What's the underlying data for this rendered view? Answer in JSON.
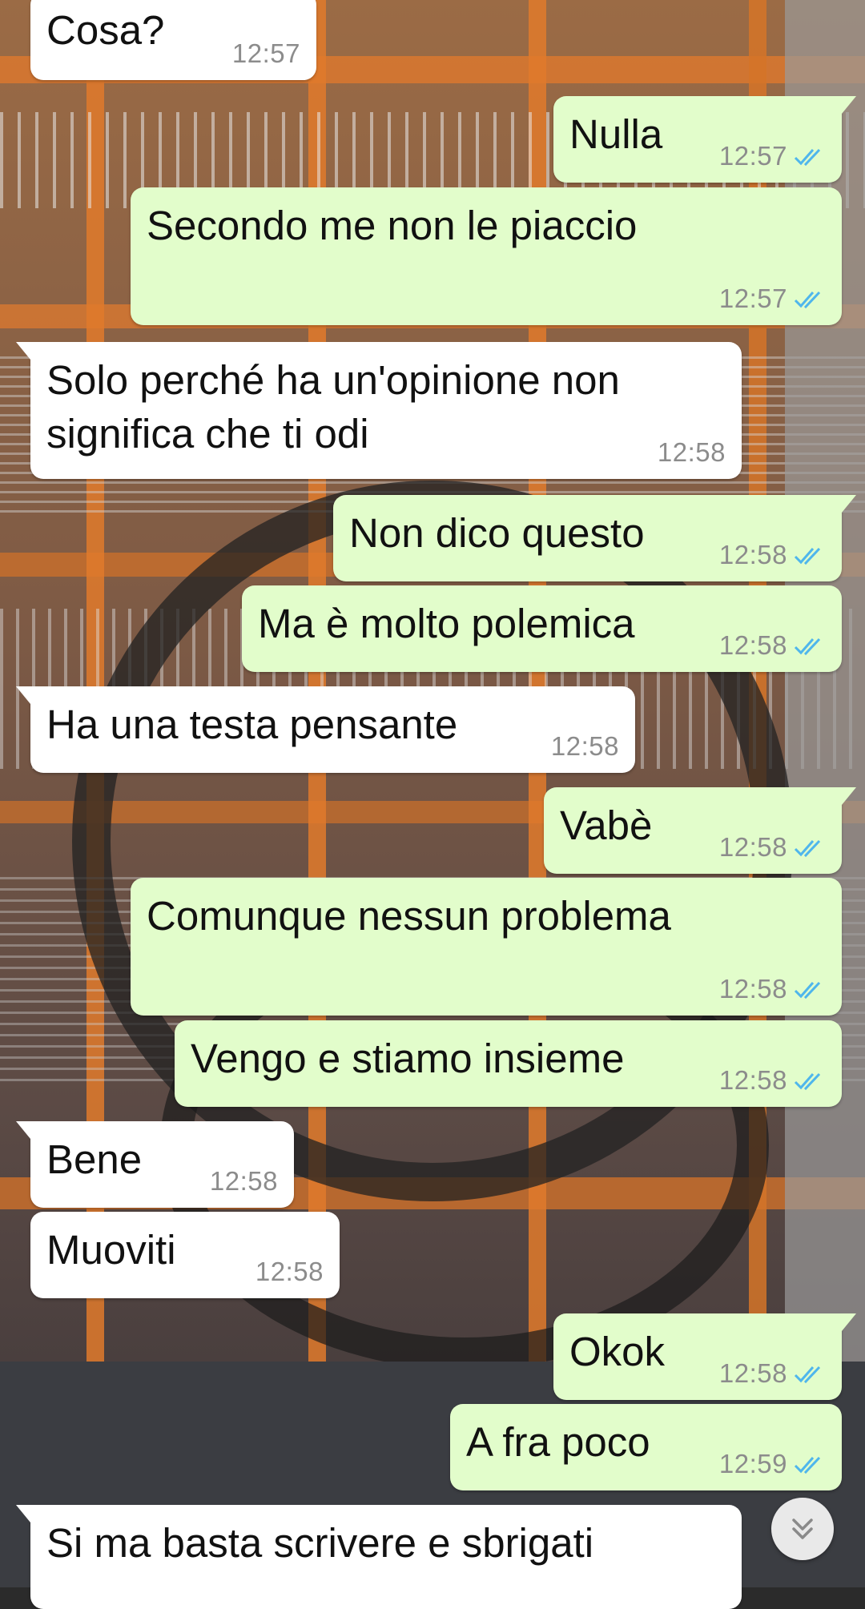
{
  "chat": {
    "messages": [
      {
        "direction": "in",
        "text": "Cosa?",
        "time": "12:57"
      },
      {
        "direction": "out",
        "text": "Nulla",
        "time": "12:57",
        "status": "read"
      },
      {
        "direction": "out",
        "text": "Secondo me non le piaccio",
        "time": "12:57",
        "status": "read"
      },
      {
        "direction": "in",
        "text": "Solo perché ha un'opinione non\nsignifica che ti odi",
        "time": "12:58"
      },
      {
        "direction": "out",
        "text": "Non dico questo",
        "time": "12:58",
        "status": "read"
      },
      {
        "direction": "out",
        "text": "Ma è molto polemica",
        "time": "12:58",
        "status": "read"
      },
      {
        "direction": "in",
        "text": "Ha una testa pensante",
        "time": "12:58"
      },
      {
        "direction": "out",
        "text": "Vabè",
        "time": "12:58",
        "status": "read"
      },
      {
        "direction": "out",
        "text": "Comunque nessun problema",
        "time": "12:58",
        "status": "read"
      },
      {
        "direction": "out",
        "text": "Vengo e stiamo insieme",
        "time": "12:58",
        "status": "read"
      },
      {
        "direction": "in",
        "text": "Bene",
        "time": "12:58"
      },
      {
        "direction": "in",
        "text": "Muoviti",
        "time": "12:58"
      },
      {
        "direction": "out",
        "text": "Okok",
        "time": "12:58",
        "status": "read"
      },
      {
        "direction": "out",
        "text": "A fra poco",
        "time": "12:59",
        "status": "read"
      },
      {
        "direction": "in",
        "text": "Si ma basta scrivere e sbrigati",
        "time": ""
      }
    ]
  },
  "scroll_button": {
    "icon": "double-chevron-down-icon"
  },
  "colors": {
    "incoming_bubble": "#ffffff",
    "outgoing_bubble": "#e2fdcb",
    "read_ticks": "#4fb6ec",
    "timestamp": "#8c8c8c",
    "wallpaper_accent": "#e07a2c"
  }
}
